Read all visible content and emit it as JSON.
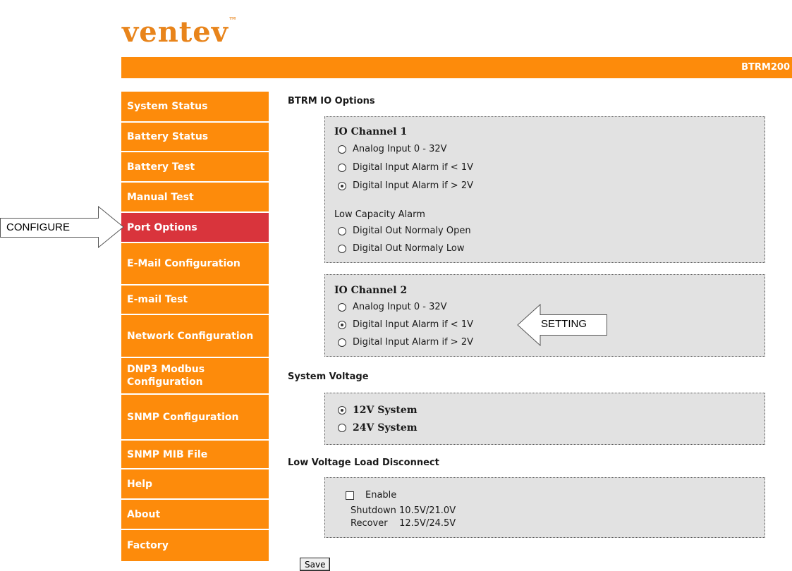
{
  "brand": {
    "logo_text": "ventev",
    "logo_mark": "™",
    "color": "#e8841b"
  },
  "header": {
    "model": "BTRM200",
    "bar_color": "#fd8b0b"
  },
  "sidebar": {
    "items": [
      {
        "label": "System Status"
      },
      {
        "label": "Battery Status"
      },
      {
        "label": "Battery Test"
      },
      {
        "label": "Manual Test"
      },
      {
        "label": "Port Options",
        "active": true
      },
      {
        "label": "E-Mail Configuration"
      },
      {
        "label": "E-mail Test"
      },
      {
        "label": "Network Configuration"
      },
      {
        "label": "DNP3 Modbus Configuration"
      },
      {
        "label": "SNMP Configuration"
      },
      {
        "label": "SNMP MIB File"
      },
      {
        "label": "Help"
      },
      {
        "label": "About"
      },
      {
        "label": "Factory"
      }
    ],
    "active_color": "#d9343c"
  },
  "annotations": {
    "configure": "CONFIGURE",
    "setting": "SETTING"
  },
  "main": {
    "io_title": "BTRM IO Options",
    "channel1": {
      "title": "IO Channel 1",
      "options": [
        "Analog Input 0 - 32V",
        "Digital Input Alarm if < 1V",
        "Digital Input Alarm if > 2V"
      ],
      "selected": 2,
      "alarm_label": "Low Capacity Alarm",
      "alarm_options": [
        "Digital Out Normaly Open",
        "Digital Out Normaly Low"
      ]
    },
    "channel2": {
      "title": "IO Channel 2",
      "options": [
        "Analog Input 0 - 32V",
        "Digital Input Alarm if < 1V",
        "Digital Input Alarm if > 2V"
      ],
      "selected": 1
    },
    "voltage_title": "System Voltage",
    "voltage": {
      "options": [
        "12V System",
        "24V System"
      ],
      "selected": 0
    },
    "lvd_title": "Low Voltage Load Disconnect",
    "lvd": {
      "enable_label": "Enable",
      "enabled": false,
      "shutdown": "Shutdown 10.5V/21.0V",
      "recover": "Recover    12.5V/24.5V"
    },
    "save_label": "Save"
  }
}
